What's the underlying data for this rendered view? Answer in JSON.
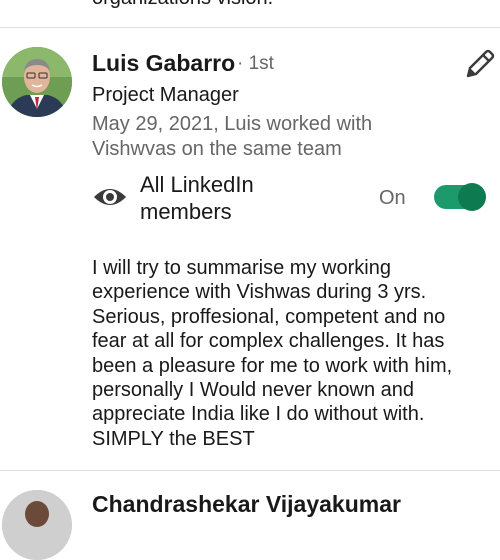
{
  "previous": {
    "tail_text": "organizations vision."
  },
  "recommendation": {
    "name": "Luis Gabarro",
    "degree": "· 1st",
    "role": "Project Manager",
    "relation": "May 29, 2021, Luis worked with Vishwvas on the same team",
    "visibility": {
      "label": "All LinkedIn members",
      "state": "On",
      "enabled": true
    },
    "text": "I will try to summarise my working experience with Vishwas during 3 yrs. Serious, proffesional, competent and no fear at all for complex challenges. It has been a pleasure for me to work with him, personally I Would never known and appreciate India like I do without with. SIMPLY the BEST"
  },
  "next": {
    "name_fragment": "Chandrashekar Vijayakumar"
  },
  "icons": {
    "edit": "pencil-icon",
    "visibility": "eye-icon"
  },
  "colors": {
    "toggle_on": "#0d7a4f",
    "toggle_track": "#1c9a6b",
    "secondary_text": "#666666"
  }
}
